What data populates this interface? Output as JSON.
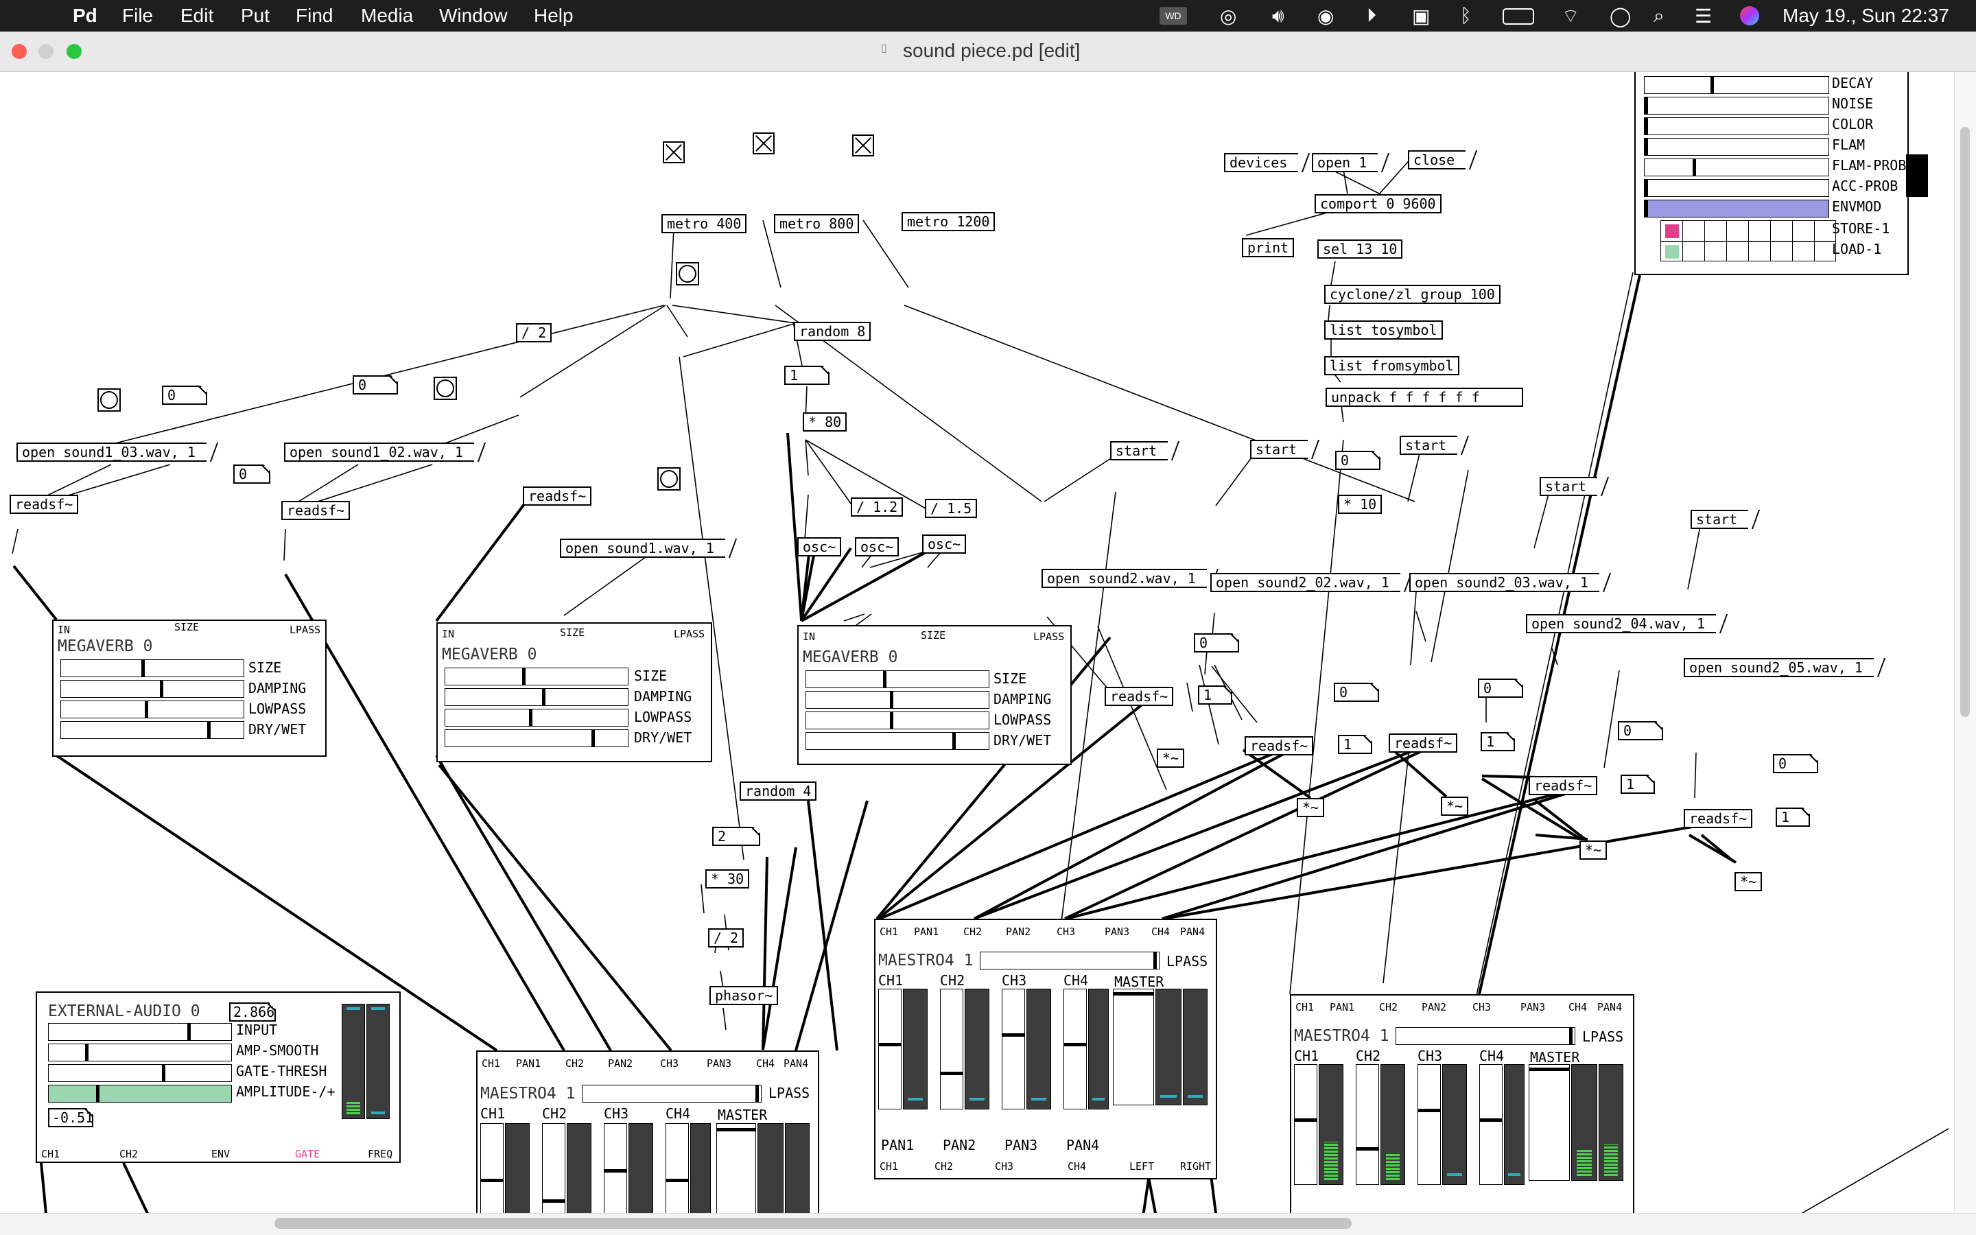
{
  "menubar": {
    "app": "Pd",
    "items": [
      "File",
      "Edit",
      "Put",
      "Find",
      "Media",
      "Window",
      "Help"
    ],
    "clock": "May 19., Sun  22:37"
  },
  "window": {
    "title": "sound piece.pd [edit]"
  },
  "objects": {
    "metro1": "metro 400",
    "metro2": "metro 800",
    "metro3": "metro 1200",
    "div2": "/ 2",
    "random8": "random 8",
    "random4": "random 4",
    "mul80": "* 80",
    "div12": "/ 1.2",
    "div15": "/ 1.5",
    "osc1": "osc~",
    "osc2": "osc~",
    "osc3": "osc~",
    "mul30": "* 30",
    "div2b": "/ 2",
    "phasor": "phasor~",
    "readsf1": "readsf~",
    "readsf2": "readsf~",
    "readsf3": "readsf~",
    "readsf4": "readsf~",
    "readsf5": "readsf~",
    "readsf6": "readsf~",
    "readsf7": "readsf~",
    "readsf8": "readsf~",
    "readsf9": "readsf~",
    "m1": "*~",
    "m2": "*~",
    "m3": "*~",
    "m4": "*~",
    "m5": "*~",
    "comport": "comport 0 9600",
    "sel": "sel 13 10",
    "print": "print",
    "zl": "cyclone/zl group 100",
    "tosym": "list tosymbol",
    "fromsym": "list fromsymbol",
    "unpack": "unpack f f f f f f",
    "mul10": "* 10"
  },
  "messages": {
    "devices": "devices",
    "open1": "open 1",
    "close": "close",
    "s103": "open sound1_03.wav, 1",
    "s102": "open sound1_02.wav, 1",
    "s1": "open sound1.wav, 1",
    "s2": "open sound2.wav, 1",
    "s202": "open sound2_02.wav, 1",
    "s203": "open sound2_03.wav, 1",
    "s204": "open sound2_04.wav, 1",
    "s205": "open sound2_05.wav, 1",
    "start": "start"
  },
  "numbers": {
    "zero": "0",
    "one": "1",
    "two": "2",
    "ext_val": "2.866",
    "ext_amp": "-0.51"
  },
  "megaverb": {
    "title": "MEGAVERB 0",
    "inlets": [
      "IN",
      "SIZE",
      "LPASS"
    ],
    "rows": [
      "SIZE",
      "DAMPING",
      "LOWPASS",
      "DRY/WET"
    ],
    "levels": [
      [
        0.44,
        0.54,
        0.46,
        0.8
      ],
      [
        0.42,
        0.53,
        0.46,
        0.8
      ],
      [
        0.42,
        0.46,
        0.46,
        0.8
      ]
    ]
  },
  "maestro": {
    "title": "MAESTRO4 1",
    "lpass": "LPASS",
    "inlets": [
      "CH1",
      "PAN1",
      "CH2",
      "PAN2",
      "CH3",
      "PAN3",
      "CH4",
      "PAN4"
    ],
    "channels": [
      "CH1",
      "CH2",
      "CH3",
      "CH4"
    ],
    "master": "MASTER",
    "pans": [
      "PAN1",
      "PAN2",
      "PAN3",
      "PAN4"
    ],
    "outlets": [
      "CH1",
      "CH2",
      "CH3",
      "CH4",
      "LEFT",
      "RIGHT"
    ]
  },
  "external": {
    "title": "EXTERNAL-AUDIO  0",
    "rows": [
      "INPUT",
      "AMP-SMOOTH",
      "GATE-THRESH",
      "AMPLITUDE-/+"
    ],
    "outlets": [
      "CH1",
      "CH2",
      "ENV",
      "GATE",
      "FREQ"
    ],
    "gate_color": "#e0408a"
  },
  "drum": {
    "rows": [
      "DECAY",
      "NOISE",
      "COLOR",
      "FLAM",
      "FLAM-PROB",
      "ACC-PROB",
      "ENVMOD"
    ],
    "store": "STORE-1",
    "load": "LOAD-1",
    "envmod_color": "#9a9ae0",
    "store_color": "#e0408a",
    "load_color": "#9ad6b0"
  },
  "colors": {
    "vu_green": "#4cd34c",
    "vu_bg": "#3c3c3c",
    "meter_mark": "#33aabb"
  }
}
